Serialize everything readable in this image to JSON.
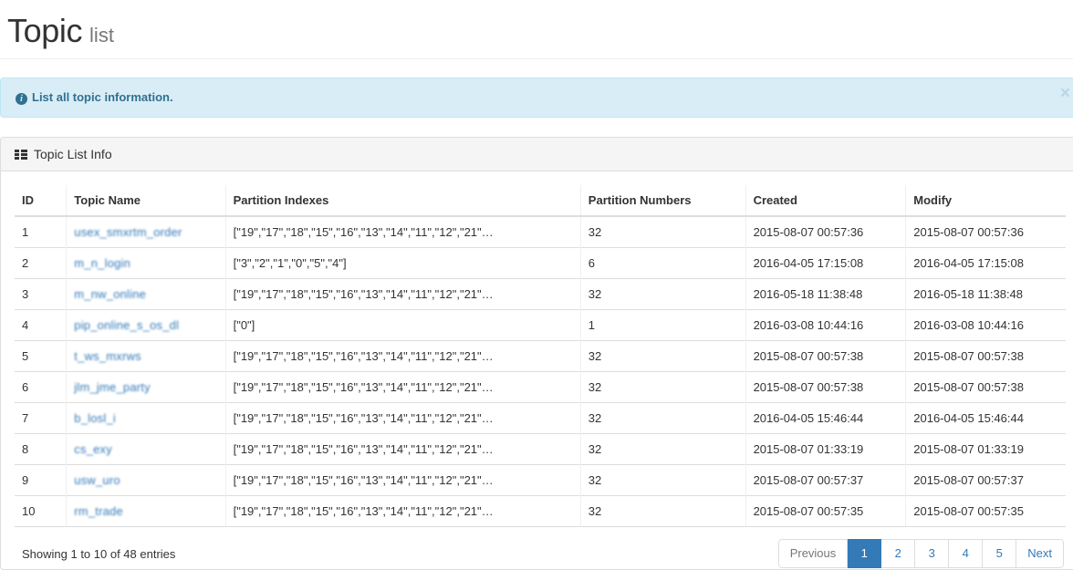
{
  "header": {
    "title": "Topic",
    "subtitle": "list"
  },
  "alert": {
    "icon": "info-circle-icon",
    "text": "List all topic information.",
    "close_label": "×",
    "bg_color": "#d9edf7",
    "border_color": "#bce8f1",
    "text_color": "#31708f"
  },
  "panel": {
    "icon": "th-list-icon",
    "heading": "Topic List Info"
  },
  "table": {
    "columns": [
      "ID",
      "Topic Name",
      "Partition Indexes",
      "Partition Numbers",
      "Created",
      "Modify"
    ],
    "rows": [
      {
        "id": "1",
        "topic_name": "usex_smxrtm_order",
        "partition_indexes": "[\"19\",\"17\",\"18\",\"15\",\"16\",\"13\",\"14\",\"11\",\"12\",\"21\"…",
        "partition_numbers": "32",
        "created": "2015-08-07 00:57:36",
        "modify": "2015-08-07 00:57:36"
      },
      {
        "id": "2",
        "topic_name": "m_n_login",
        "partition_indexes": "[\"3\",\"2\",\"1\",\"0\",\"5\",\"4\"]",
        "partition_numbers": "6",
        "created": "2016-04-05 17:15:08",
        "modify": "2016-04-05 17:15:08"
      },
      {
        "id": "3",
        "topic_name": "m_nw_online",
        "partition_indexes": "[\"19\",\"17\",\"18\",\"15\",\"16\",\"13\",\"14\",\"11\",\"12\",\"21\"…",
        "partition_numbers": "32",
        "created": "2016-05-18 11:38:48",
        "modify": "2016-05-18 11:38:48"
      },
      {
        "id": "4",
        "topic_name": "pip_online_s_os_dl",
        "partition_indexes": "[\"0\"]",
        "partition_numbers": "1",
        "created": "2016-03-08 10:44:16",
        "modify": "2016-03-08 10:44:16"
      },
      {
        "id": "5",
        "topic_name": "t_ws_mxrws",
        "partition_indexes": "[\"19\",\"17\",\"18\",\"15\",\"16\",\"13\",\"14\",\"11\",\"12\",\"21\"…",
        "partition_numbers": "32",
        "created": "2015-08-07 00:57:38",
        "modify": "2015-08-07 00:57:38"
      },
      {
        "id": "6",
        "topic_name": "jlm_jme_party",
        "partition_indexes": "[\"19\",\"17\",\"18\",\"15\",\"16\",\"13\",\"14\",\"11\",\"12\",\"21\"…",
        "partition_numbers": "32",
        "created": "2015-08-07 00:57:38",
        "modify": "2015-08-07 00:57:38"
      },
      {
        "id": "7",
        "topic_name": "b_losl_i",
        "partition_indexes": "[\"19\",\"17\",\"18\",\"15\",\"16\",\"13\",\"14\",\"11\",\"12\",\"21\"…",
        "partition_numbers": "32",
        "created": "2016-04-05 15:46:44",
        "modify": "2016-04-05 15:46:44"
      },
      {
        "id": "8",
        "topic_name": "cs_exy",
        "partition_indexes": "[\"19\",\"17\",\"18\",\"15\",\"16\",\"13\",\"14\",\"11\",\"12\",\"21\"…",
        "partition_numbers": "32",
        "created": "2015-08-07 01:33:19",
        "modify": "2015-08-07 01:33:19"
      },
      {
        "id": "9",
        "topic_name": "usw_uro",
        "partition_indexes": "[\"19\",\"17\",\"18\",\"15\",\"16\",\"13\",\"14\",\"11\",\"12\",\"21\"…",
        "partition_numbers": "32",
        "created": "2015-08-07 00:57:37",
        "modify": "2015-08-07 00:57:37"
      },
      {
        "id": "10",
        "topic_name": "rm_trade",
        "partition_indexes": "[\"19\",\"17\",\"18\",\"15\",\"16\",\"13\",\"14\",\"11\",\"12\",\"21\"…",
        "partition_numbers": "32",
        "created": "2015-08-07 00:57:35",
        "modify": "2015-08-07 00:57:35"
      }
    ]
  },
  "footer": {
    "info": "Showing 1 to 10 of 48 entries",
    "pagination": [
      {
        "label": "Previous",
        "state": "disabled",
        "name": "pagination-previous"
      },
      {
        "label": "1",
        "state": "active",
        "name": "pagination-page-1"
      },
      {
        "label": "2",
        "state": "normal",
        "name": "pagination-page-2"
      },
      {
        "label": "3",
        "state": "normal",
        "name": "pagination-page-3"
      },
      {
        "label": "4",
        "state": "normal",
        "name": "pagination-page-4"
      },
      {
        "label": "5",
        "state": "normal",
        "name": "pagination-page-5"
      },
      {
        "label": "Next",
        "state": "normal",
        "name": "pagination-next"
      }
    ],
    "accent_color": "#337ab7"
  }
}
